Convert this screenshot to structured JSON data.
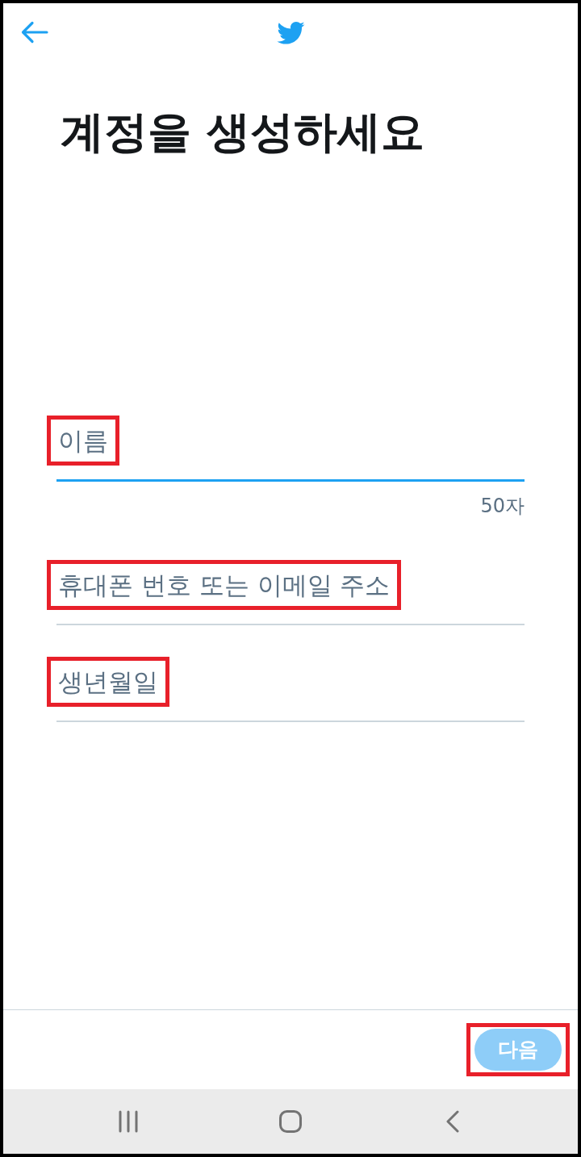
{
  "title": "계정을 생성하세요",
  "fields": [
    {
      "placeholder": "이름",
      "focused": true,
      "highlighted": true,
      "counter": "50자"
    },
    {
      "placeholder": "휴대폰 번호 또는 이메일 주소",
      "focused": false,
      "highlighted": true
    },
    {
      "placeholder": "생년월일",
      "focused": false,
      "highlighted": true
    }
  ],
  "next_button": {
    "label": "다음",
    "disabled": true,
    "highlighted": true
  }
}
